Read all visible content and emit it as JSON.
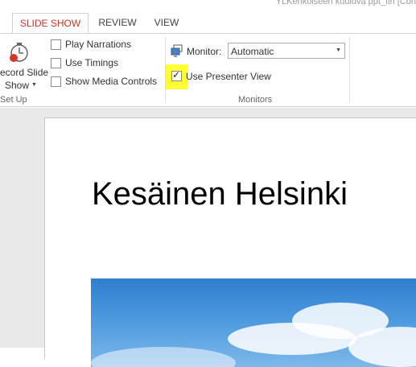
{
  "window": {
    "title": "YLKerikoiseen kuuluva ppt_fin [Con"
  },
  "tabs": [
    {
      "label": "SLIDE SHOW",
      "active": true
    },
    {
      "label": "REVIEW",
      "active": false
    },
    {
      "label": "VIEW",
      "active": false
    }
  ],
  "setup_group": {
    "record_label_line1": "ecord Slide",
    "record_label_line2": "Show",
    "label": "Set Up",
    "checkboxes": [
      {
        "label": "Play Narrations",
        "checked": false
      },
      {
        "label": "Use Timings",
        "checked": false
      },
      {
        "label": "Show Media Controls",
        "checked": false
      }
    ]
  },
  "monitors_group": {
    "monitor_label": "Monitor:",
    "monitor_value": "Automatic",
    "presenter_view_label": "Use Presenter View",
    "presenter_view_checked": true,
    "label": "Monitors"
  },
  "slide": {
    "title": "Kesäinen Helsinki"
  },
  "colors": {
    "accent": "#c0392b",
    "highlight": "#ffff33",
    "sky": "#3a88d6"
  }
}
